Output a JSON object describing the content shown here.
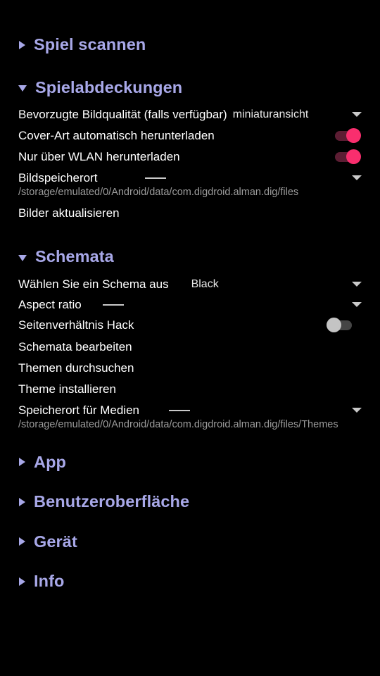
{
  "theme": {
    "background": "#000000",
    "header_color": "#a8a8e8",
    "primary_text": "#ffffff",
    "summary_text": "#9b9b9b",
    "switch_on_thumb": "#f92e6e",
    "switch_on_track": "#5c1d33",
    "switch_off_thumb": "#c4c4c4",
    "switch_off_track": "#454545"
  },
  "sections": {
    "scan": {
      "label": "Spiel scannen",
      "expanded": false,
      "icon": "triangle-right-icon"
    },
    "covers": {
      "label": "Spielabdeckungen",
      "expanded": true,
      "icon": "triangle-down-icon",
      "rows": {
        "image_quality": {
          "title": "Bevorzugte Bildqualität (falls verfügbar)",
          "value": "miniaturansicht",
          "caret": "chevron-down-icon"
        },
        "auto_download": {
          "title": "Cover-Art automatisch herunterladen",
          "switch": "on"
        },
        "wifi_only": {
          "title": "Nur über WLAN herunterladen",
          "switch": "on"
        },
        "image_location": {
          "title": "Bildspeicherort",
          "value": "------",
          "caret": "chevron-down-icon",
          "summary": "/storage/emulated/0/Android/data/com.digdroid.alman.dig/files"
        },
        "refresh_images": {
          "title": "Bilder aktualisieren"
        }
      }
    },
    "schemes": {
      "label": "Schemata",
      "expanded": true,
      "icon": "triangle-down-icon",
      "rows": {
        "choose_scheme": {
          "title": "Wählen Sie ein Schema aus",
          "value": "Black",
          "caret": "chevron-down-icon"
        },
        "aspect_ratio": {
          "title": "Aspect ratio",
          "value": "------",
          "caret": "chevron-down-icon"
        },
        "aspect_hack": {
          "title": "Seitenverhältnis Hack",
          "switch": "off"
        },
        "edit_schemes": {
          "title": "Schemata bearbeiten"
        },
        "browse_themes": {
          "title": "Themen durchsuchen"
        },
        "install_theme": {
          "title": "Theme installieren"
        },
        "media_location": {
          "title": "Speicherort für Medien",
          "value": "------",
          "caret": "chevron-down-icon",
          "summary": "/storage/emulated/0/Android/data/com.digdroid.alman.dig/files/Themes"
        }
      }
    },
    "app": {
      "label": "App",
      "expanded": false,
      "icon": "triangle-right-icon"
    },
    "ui": {
      "label": "Benutzeroberfläche",
      "expanded": false,
      "icon": "triangle-right-icon"
    },
    "device": {
      "label": "Gerät",
      "expanded": false,
      "icon": "triangle-right-icon"
    },
    "info": {
      "label": "Info",
      "expanded": false,
      "icon": "triangle-right-icon"
    }
  }
}
